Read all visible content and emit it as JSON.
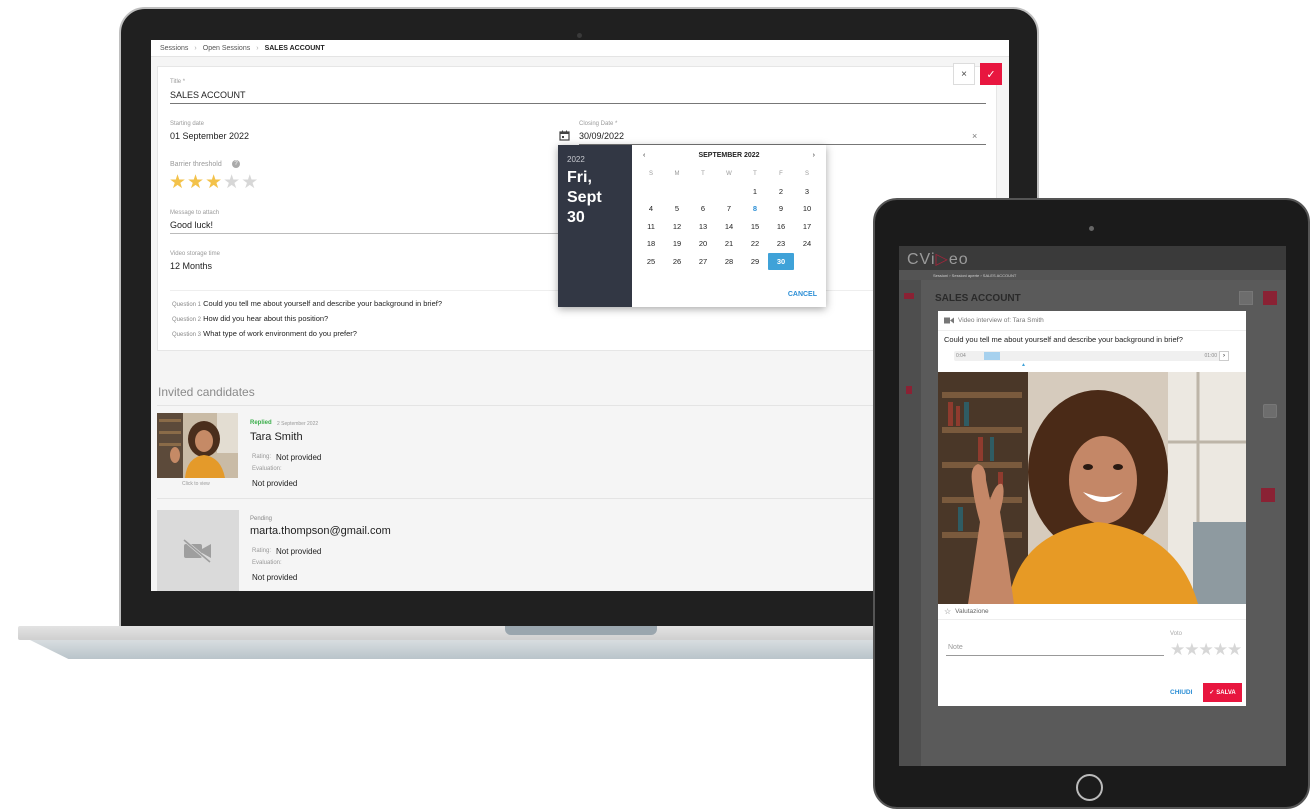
{
  "laptop": {
    "breadcrumb": [
      "Sessions",
      "Open Sessions",
      "SALES ACCOUNT"
    ],
    "form": {
      "title_label": "Title *",
      "title_value": "SALES ACCOUNT",
      "starting_label": "Starting date",
      "starting_value": "01 September 2022",
      "closing_label": "Closing Date *",
      "closing_value": "30/09/2022",
      "barrier_label": "Barrier threshold",
      "barrier_rating": 3,
      "barrier_max": 5,
      "message_label": "Message to attach",
      "message_value": "Good luck!",
      "storage_label": "Video storage time",
      "storage_value": "12 Months"
    },
    "questions": [
      {
        "num": "Question 1",
        "text": "Could you tell me about yourself and describe your background in brief?"
      },
      {
        "num": "Question 2",
        "text": "How did you hear about this position?"
      },
      {
        "num": "Question 3",
        "text": "What type of work environment do you prefer?"
      }
    ],
    "invited_title": "Invited candidates",
    "candidates": [
      {
        "status": "Replied",
        "date": "2 September 2022",
        "name": "Tara Smith",
        "rating_label": "Rating:",
        "rating_value": "Not provided",
        "evaluation_label": "Evaluation:",
        "evaluation_value": "Not provided",
        "thumb_caption": "Click to view"
      },
      {
        "status": "Pending",
        "name": "marta.thompson@gmail.com",
        "rating_label": "Rating:",
        "rating_value": "Not provided",
        "evaluation_label": "Evaluation:",
        "evaluation_value": "Not provided"
      }
    ],
    "datepicker": {
      "year": "2022",
      "weekday": "Fri,",
      "date": "Sept 30",
      "month_title": "SEPTEMBER 2022",
      "prev": "‹",
      "next": "›",
      "dow": [
        "S",
        "M",
        "T",
        "W",
        "T",
        "F",
        "S"
      ],
      "first_weekday": 4,
      "days_in_month": 30,
      "today": 8,
      "selected": 30,
      "cancel": "CANCEL"
    },
    "icons": {
      "close": "×",
      "check": "✓",
      "calendar": "calendar-icon",
      "help": "?"
    }
  },
  "tablet": {
    "logo_a": "CVi",
    "logo_b": "eo",
    "breadcrumb": "Sessioni  ›  Sessioni aperte  ›  SALES ACCOUNT",
    "session_title": "SALES ACCOUNT",
    "modal": {
      "header": "Video interview of: Tara Smith",
      "question": "Could you tell me about yourself and describe your background in brief?",
      "time_start": "0:04",
      "time_end": "01:00",
      "rating_section": "Valutazione",
      "voto_label": "Voto",
      "note_label": "Note",
      "close": "CHIUDI",
      "save": "SALVA"
    }
  },
  "colors": {
    "accent_red": "#e8163f",
    "link_blue": "#2c8fd6",
    "star_gold": "#f3c24a",
    "dp_dark": "#323744"
  }
}
